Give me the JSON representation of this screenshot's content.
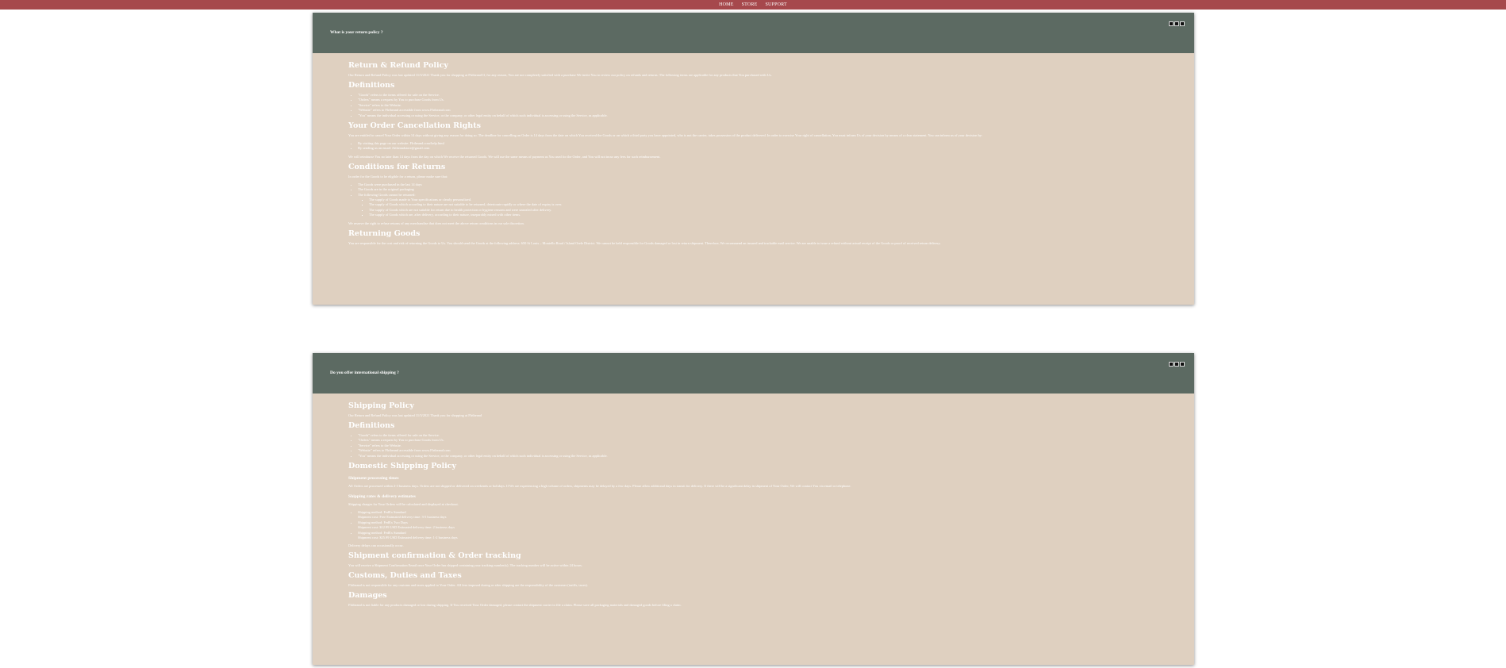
{
  "nav": {
    "items": [
      "HOME",
      "STORE",
      "SUPPORT"
    ]
  },
  "colors": {
    "topbar": "#a6484c",
    "panel_header": "#5c6a62",
    "panel_body": "#dfd0c0",
    "text": "#ffffff"
  },
  "panels": [
    {
      "question": "What is your return policy ?",
      "title": "Return & Refund Policy",
      "intro": "Our Return and Refund Policy was last updated 11/3/2021 Thank you for shopping at Flrtheand If, for any reason, You are not completely satisfied with a purchase We invite You to review our policy on refunds and returns. The following terms are applicable for any products that You purchased with Us.",
      "definitions_title": "Definitions",
      "definitions": [
        "\"Goods\" refers to the items offered for sale on the Service.",
        "\"Orders\" means a request by You to purchase Goods from Us.",
        "\"Service\" refers to the Website.",
        "\"Website\" refers to Flrtheand accessible from www.Flrtheand.com",
        "\"You\" means the individual accessing or using the Service, or the company, or other legal entity on behalf of which such individual is accessing or using the Service, as applicable."
      ],
      "cancel_title": "Your Order Cancellation Rights",
      "cancel_text": "You are entitled to cancel Your Order within 14 days without giving any reason for doing so. The deadline for cancelling an Order is 14 days from the date on which You received the Goods or on which a third party you have appointed, who is not the carrier, takes possession of the product delivered. In order to exercise Your right of cancellation, You must inform Us of your decision by means of a clear statement. You can inform us of your decision by:",
      "cancel_methods": [
        "By visiting this page on our website: Flrtheand.com/help.html",
        "By sending us an email: flrtheandstore@gmail.com"
      ],
      "reimburse_text": "We will reimburse You no later than 14 days from the day on which We receive the returned Goods. We will use the same means of payment as You used for the Order, and You will not incur any fees for such reimbursement.",
      "conditions_title": "Conditions for Returns",
      "conditions_intro": "In order for the Goods to be eligible for a return, please make sure that:",
      "conditions": [
        "The Goods were purchased in the last 14 days",
        "The Goods are in the original packaging",
        "The following Goods cannot be returned:"
      ],
      "exclusions": [
        "The supply of Goods made to Your specifications or clearly personalized.",
        "The supply of Goods which according to their nature are not suitable to be returned, deteriorate rapidly or where the date of expiry is over.",
        "The supply of Goods which are not suitable for return due to health protection or hygiene reasons and were unsealed after delivery.",
        "The supply of Goods which are, after delivery, according to their nature, inseparably mixed with other items."
      ],
      "reserve_text": "We reserve the right to refuse returns of any merchandise that does not meet the above return conditions in our sole discretion.",
      "returning_title": "Returning Goods",
      "returning_text": "You are responsible for the cost and risk of returning the Goods to Us. You should send the Goods at the following address: 650 St Louis – Montello Road / Island Orele District. We cannot be held responsible for Goods damaged or lost in return shipment. Therefore, We recommend an insured and trackable mail service. We are unable to issue a refund without actual receipt of the Goods or proof of received return delivery."
    },
    {
      "question": "Do you offer international shipping ?",
      "title": "Shipping Policy",
      "intro": "Our Return and Refund Policy was last updated 11/3/2021 Thank you for shopping at Flrtheand",
      "definitions_title": "Definitions",
      "definitions": [
        "\"Goods\" refers to the items offered for sale on the Service.",
        "\"Orders\" means a request by You to purchase Goods from Us.",
        "\"Service\" refers to the Website.",
        "\"Website\" refers to Flrtheand accessible from www.Flrtheand.com",
        "\"You\" means the individual accessing or using the Service, or the company, or other legal entity on behalf of which such individual is accessing or using the Service, as applicable."
      ],
      "domestic_title": "Domestic Shipping Policy",
      "processing_title": "Shipment processing times",
      "processing_text": "All Orders are processed within 2-3 business days. Orders are not shipped or delivered on weekends or holidays. If We are experiencing a high volume of orders, shipments may be delayed by a few days. Please allow additional days in transit for delivery. If there will be a significant delay in shipment of Your Order, We will contact You via email or telephone.",
      "rates_title": "Shipping rates & delivery estimates",
      "rates_intro": "Shipping charges for Your Orders will be calculated and displayed at checkout.",
      "rates": [
        "Shipping method: FedEx Standard",
        "Shipment cost: Free Estimated delivery time: 3-5 business days",
        "Shipping method: FedEx Two Days",
        "Shipment cost: $12.99 USD Estimated delivery time: 2 business days",
        "Shipping method: FedEx Standard",
        "Shipment cost: $25.99 USD Estimated delivery time: 1-2 business days"
      ],
      "delays_text": "Delivery delays can occasionally occur.",
      "confirm_title": "Shipment confirmation & Order tracking",
      "confirm_text": "You will receive a Shipment Confirmation Email once Your Order has shipped containing your tracking number(s). The tracking number will be active within 24 hours.",
      "customs_title": "Customs, Duties and Taxes",
      "customs_text": "Flrtheand is not responsible for any customs and taxes applied to Your Order. All fees imposed during or after shipping are the responsibility of the customer (tariffs, taxes).",
      "damages_title": "Damages",
      "damages_text": "Flrtheand is not liable for any products damaged or lost during shipping. If You received Your Order damaged, please contact the shipment carrier to file a claim. Please save all packaging materials and damaged goods before filing a claim."
    }
  ]
}
